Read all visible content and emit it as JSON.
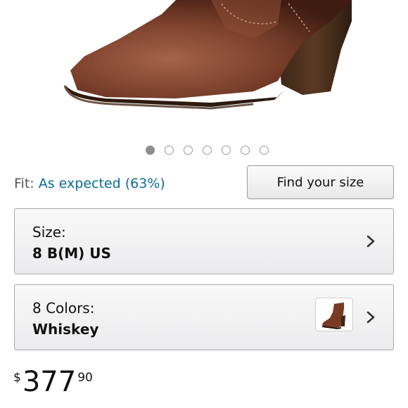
{
  "gallery": {
    "image_alt": "brown leather ankle boot",
    "dot_count": 7,
    "active_index": 0
  },
  "fit": {
    "label": "Fit:",
    "value": "As expected (63%)"
  },
  "find_size": {
    "label": "Find your size"
  },
  "size_selector": {
    "label": "Size:",
    "value": "8 B(M) US",
    "icon": "chevron-right-icon"
  },
  "color_selector": {
    "label": "8 Colors:",
    "value": "Whiskey",
    "icon": "chevron-right-icon"
  },
  "price": {
    "currency": "$",
    "whole": "377",
    "fraction": "90"
  },
  "colors": {
    "link": "#0a6b9c",
    "boot_leather": "#6e3a24",
    "heel": "#4a2d1c"
  }
}
